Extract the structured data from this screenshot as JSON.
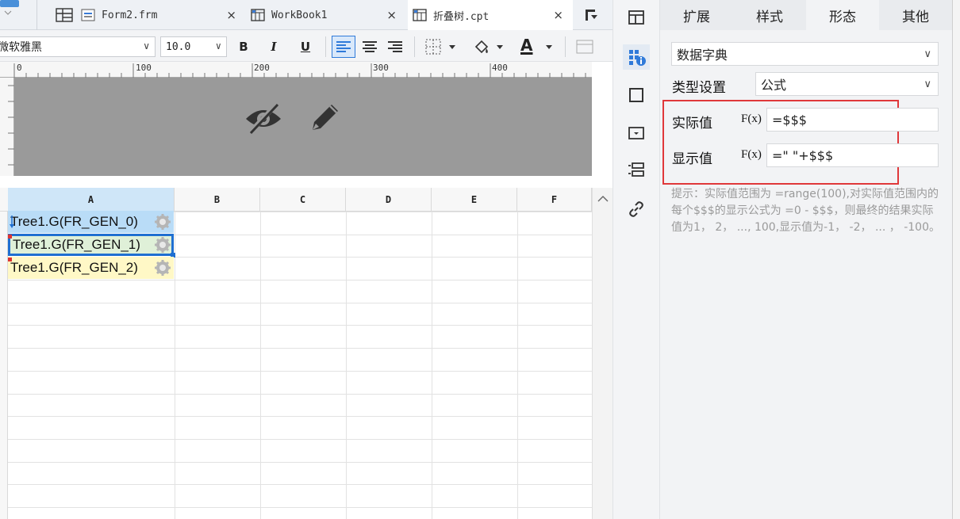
{
  "tabs": [
    {
      "label": "Form2.frm",
      "icon": "form-icon"
    },
    {
      "label": "WorkBook1",
      "icon": "workbook-icon"
    },
    {
      "label": "折叠树.cpt",
      "icon": "report-icon"
    }
  ],
  "tab_close_glyph": "×",
  "toolbar": {
    "font_name": "微软雅黑",
    "font_size": "10.0",
    "bold": "B",
    "italic": "I",
    "underline": "U",
    "font_color_label": "A"
  },
  "ruler": {
    "marks": [
      "0",
      "100",
      "200",
      "300",
      "400"
    ]
  },
  "grid": {
    "columns": [
      "A",
      "B",
      "C",
      "D",
      "E",
      "F"
    ],
    "cells": [
      "Tree1.G(FR_GEN_0)",
      "Tree1.G(FR_GEN_1)",
      "Tree1.G(FR_GEN_2)"
    ]
  },
  "panel": {
    "tabs": [
      "扩展",
      "样式",
      "形态",
      "其他"
    ],
    "active_tab": "形态",
    "form_type": "数据字典",
    "type_setting_label": "类型设置",
    "type_setting_value": "公式",
    "actual_value_label": "实际值",
    "actual_value": "=$$$",
    "display_value_label": "显示值",
    "display_value": "=\" \"+$$$",
    "fx_label": "F(x)",
    "hint": "提示：实际值范围为 =range(100),对实际值范围内的每个$$$的显示公式为 =0 - $$$，则最终的结果实际值为1， 2， ..., 100,显示值为-1， -2， ... ， -100。"
  },
  "colors": {
    "accent": "#1f6fd1",
    "highlight_box": "#e0383a",
    "selected_cell": "#b9dcf7"
  }
}
